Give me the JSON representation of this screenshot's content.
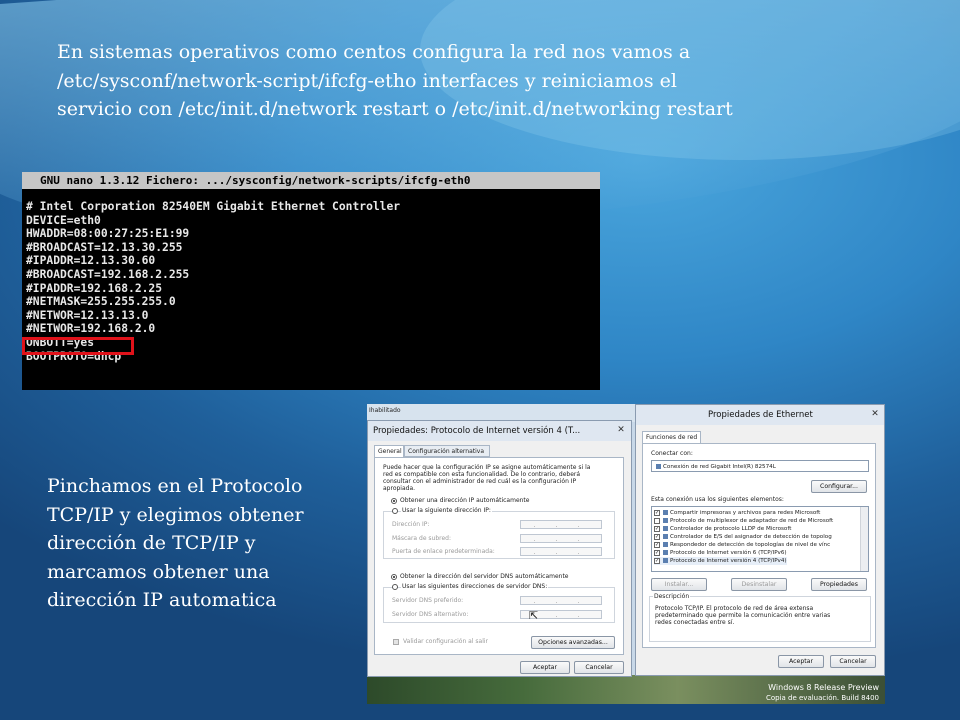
{
  "slide": {
    "heading_text": "En sistemas operativos como  centos configura la red nos vamos a /etc/sysconf/network-script/ifcfg-etho interfaces y reiniciamos el servicio con /etc/init.d/network restart o /etc/init.d/networking restart",
    "side_text": "Pinchamos en el Protocolo TCP/IP y elegimos obtener dirección de TCP/IP y marcamos obtener una dirección IP automatica"
  },
  "terminal": {
    "title": "GNU nano 1.3.12 Fichero: .../sysconfig/network-scripts/ifcfg-eth0",
    "lines": [
      "# Intel Corporation 82540EM Gigabit Ethernet Controller",
      "DEVICE=eth0",
      "HWADDR=08:00:27:25:E1:99",
      "#BROADCAST=12.13.30.255",
      "#IPADDR=12.13.30.60",
      "#BROADCAST=192.168.2.255",
      "#IPADDR=192.168.2.25",
      "#NETMASK=255.255.255.0",
      "#NETWOR=12.13.13.0",
      "#NETWOR=192.168.2.0",
      "ONBOTT=yes",
      "BOOTPROTO=dhcp"
    ],
    "highlight_color": "#e0121a"
  },
  "screenshot": {
    "top_fragment": "Ihabilitado",
    "windows_watermark": [
      "Windows 8 Release Preview",
      "Copia de evaluación. Build 8400"
    ],
    "ipv4_dialog": {
      "title": "Propiedades: Protocolo de Internet versión 4 (T...",
      "tabs": [
        "General",
        "Configuración alternativa"
      ],
      "intro": [
        "Puede hacer que la configuración IP se asigne automáticamente si la",
        "red es compatible con esta funcionalidad. De lo contrario, deberá",
        "consultar con el administrador de red cuál es la configuración IP",
        "apropiada."
      ],
      "radio_auto_ip": "Obtener una dirección IP automáticamente",
      "radio_manual_ip": "Usar la siguiente dirección IP:",
      "field_ip": "Dirección IP:",
      "field_mask": "Máscara de subred:",
      "field_gateway": "Puerta de enlace predeterminada:",
      "radio_auto_dns": "Obtener la dirección del servidor DNS automáticamente",
      "radio_manual_dns": "Usar las siguientes direcciones de servidor DNS:",
      "field_dns1": "Servidor DNS preferido:",
      "field_dns2": "Servidor DNS alternativo:",
      "ip_placeholder": ". . .",
      "validate_label": "Validar configuración al salir",
      "advanced_button": "Opciones avanzadas...",
      "ok_button": "Aceptar",
      "cancel_button": "Cancelar"
    },
    "ethernet_dialog": {
      "title": "Propiedades de Ethernet",
      "tab": "Funciones de red",
      "connect_label": "Conectar con:",
      "adapter": "Conexión de red Gigabit Intel(R) 82574L",
      "configure_button": "Configurar...",
      "items_label": "Esta conexión usa los siguientes elementos:",
      "items": [
        {
          "label": "Compartir impresoras y archivos para redes Microsoft",
          "checked": true
        },
        {
          "label": "Protocolo de multiplexor de adaptador de red de Microsoft",
          "checked": false
        },
        {
          "label": "Controlador de protocolo LLDP de Microsoft",
          "checked": true
        },
        {
          "label": "Controlador de E/S del asignador de detección de topolog",
          "checked": true
        },
        {
          "label": "Respondedor de detección de topologías de nivel de vínc",
          "checked": true
        },
        {
          "label": "Protocolo de Internet versión 6 (TCP/IPv6)",
          "checked": true
        },
        {
          "label": "Protocolo de Internet versión 4 (TCP/IPv4)",
          "checked": true
        }
      ],
      "install_button": "Instalar...",
      "uninstall_button": "Desinstalar",
      "properties_button": "Propiedades",
      "description_label": "Descripción",
      "description_text": [
        "Protocolo TCP/IP. El protocolo de red de área extensa",
        "predeterminado que permite la comunicación entre varias",
        "redes conectadas entre sí."
      ],
      "ok_button": "Aceptar",
      "cancel_button": "Cancelar"
    }
  }
}
